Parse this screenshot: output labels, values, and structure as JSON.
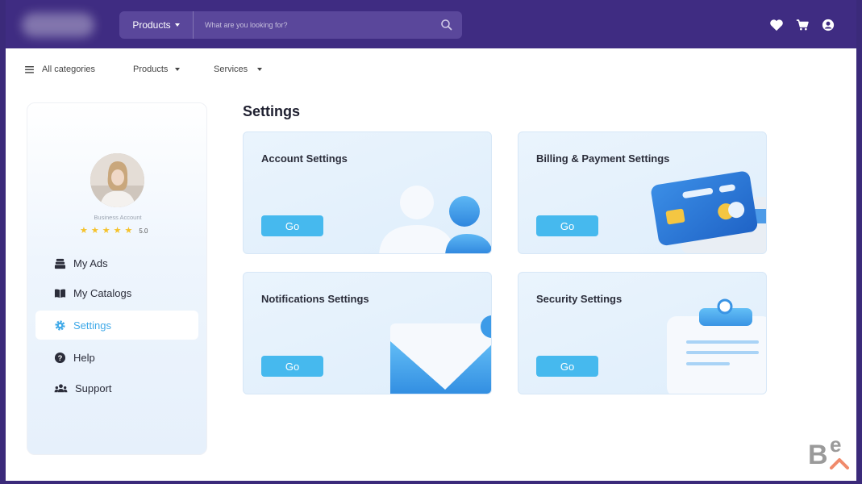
{
  "header": {
    "search_category": "Products",
    "search_placeholder": "What are you looking for?"
  },
  "subnav": {
    "all_categories": "All categories",
    "products": "Products",
    "services": "Services"
  },
  "profile": {
    "account_type": "Business Account",
    "rating_value": "5.0",
    "stars": 5
  },
  "sidebar": {
    "items": [
      {
        "label": "My Ads",
        "icon": "inbox-stack-icon"
      },
      {
        "label": "My Catalogs",
        "icon": "open-book-icon"
      },
      {
        "label": "Settings",
        "icon": "gear-icon",
        "active": true
      },
      {
        "label": "Help",
        "icon": "question-circle-icon"
      },
      {
        "label": "Support",
        "icon": "users-group-icon"
      }
    ]
  },
  "main": {
    "title": "Settings",
    "cards": [
      {
        "title": "Account Settings",
        "button": "Go",
        "icon": "user-illustration"
      },
      {
        "title": "Billing & Payment Settings",
        "button": "Go",
        "icon": "credit-card-illustration"
      },
      {
        "title": "Notifications Settings",
        "button": "Go",
        "icon": "envelope-illustration"
      },
      {
        "title": "Security Settings",
        "button": "Go",
        "icon": "clipboard-illustration"
      }
    ]
  },
  "colors": {
    "topbar": "#3f2c82",
    "accent": "#46b9ee",
    "active_text": "#3fa9e8",
    "card_bg": "#e3f0fc"
  }
}
